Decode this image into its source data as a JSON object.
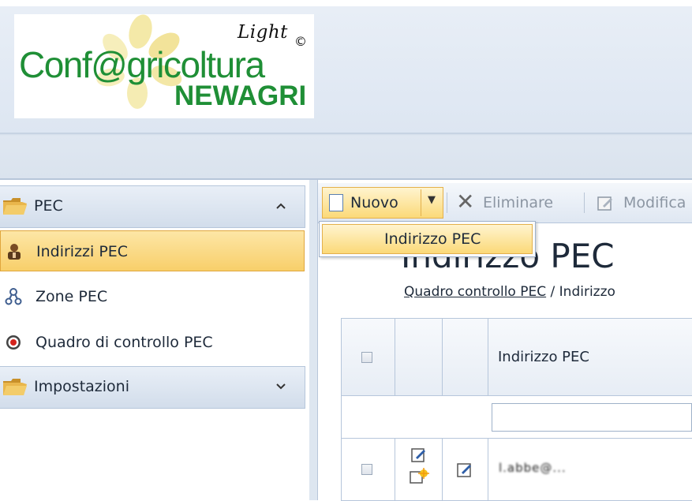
{
  "logo": {
    "brand": "Conf@gricoltura",
    "sub": "NEWAGRI",
    "edition": "Light",
    "copyright": "©"
  },
  "sidebar": {
    "groups": [
      {
        "label": "PEC",
        "expanded": true,
        "icon": "folder-icon",
        "chevron": "^"
      },
      {
        "label": "Impostazioni",
        "expanded": false,
        "icon": "folder-icon",
        "chevron": "v"
      }
    ],
    "items": [
      {
        "label": "Indirizzi PEC",
        "icon": "user-icon",
        "selected": true
      },
      {
        "label": "Zone PEC",
        "icon": "network-icon",
        "selected": false
      },
      {
        "label": "Quadro di controllo PEC",
        "icon": "target-icon",
        "selected": false
      }
    ]
  },
  "toolbar": {
    "nuovo_label": "Nuovo",
    "dropdown_arrow": "▼",
    "eliminare_label": "Eliminare",
    "modifica_label": "Modifica"
  },
  "dropdown": {
    "items": [
      {
        "label": "Indirizzo PEC"
      }
    ]
  },
  "page": {
    "title": "Indirizzo PEC",
    "breadcrumb_link": "Quadro controllo PEC",
    "breadcrumb_sep": " / ",
    "breadcrumb_current": "Indirizzo"
  },
  "grid": {
    "columns": [
      "",
      "",
      "",
      "Indirizzo PEC"
    ],
    "rows": [
      {
        "value": "l.abbe@..."
      }
    ]
  },
  "colors": {
    "brand_green": "#1f8f36",
    "selected_bg": "#f8cf6a",
    "header_bg": "#dde6f2",
    "border": "#b6c6db"
  }
}
